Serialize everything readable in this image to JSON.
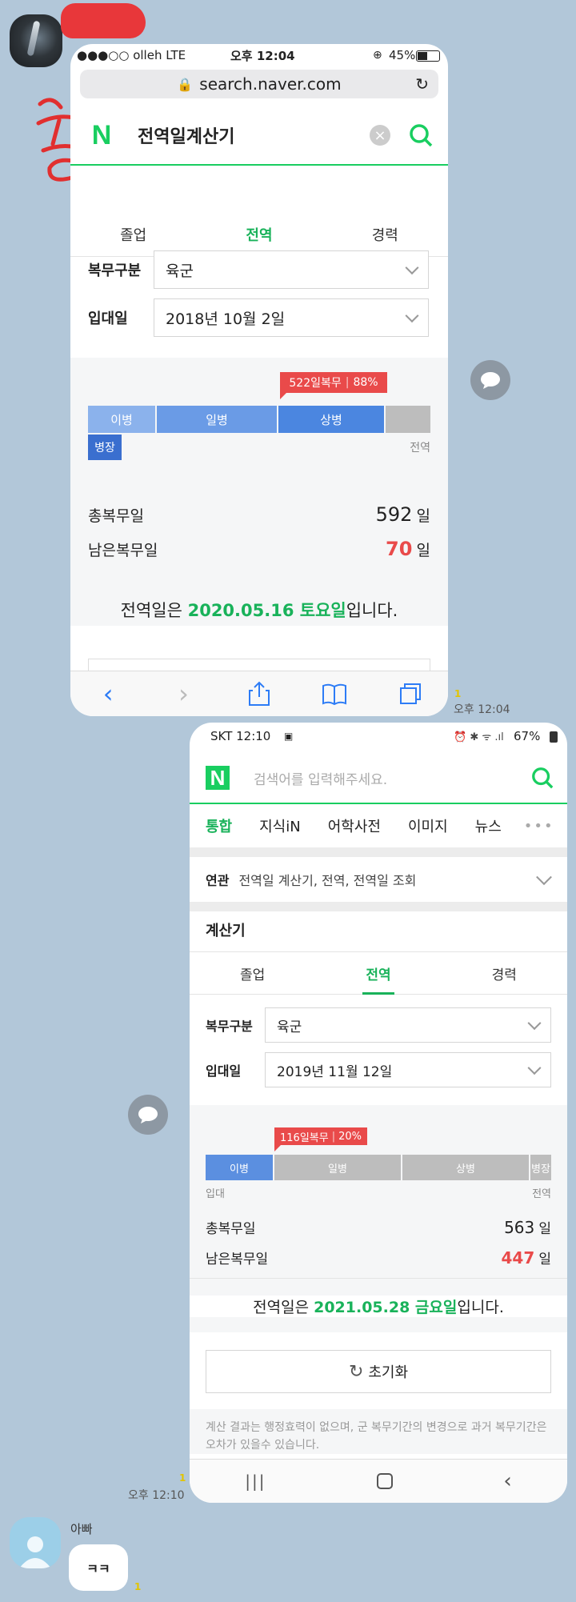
{
  "card1": {
    "status": {
      "carrier": "●●●○○ olleh  LTE",
      "time": "오후 12:04",
      "battery": "45%"
    },
    "url": "search.naver.com",
    "search_title": "전역일계산기",
    "tabs": [
      "졸업",
      "전역",
      "경력"
    ],
    "branch_label": "복무구분",
    "branch_value": "육군",
    "enlist_label": "입대일",
    "enlist_value": "2018년 10월 2일",
    "badge_days": "522일복무",
    "badge_pct": "88%",
    "segments": [
      "이병",
      "일병",
      "상병"
    ],
    "rank_now": "병장",
    "end_label": "전역",
    "total_label": "총복무일",
    "total_value": "592",
    "day_unit": "일",
    "remain_label": "남은복무일",
    "remain_value": "70",
    "result_pre": "전역일은 ",
    "result_date": "2020.05.16 토요일",
    "result_post": "입니다.",
    "progress_pct": 88
  },
  "msg1": {
    "read": "1",
    "time": "오후 12:04"
  },
  "card2": {
    "status": {
      "carrier": "SKT 12:10",
      "battery": "67%"
    },
    "search_placeholder": "검색어를 입력해주세요.",
    "nav": [
      "통합",
      "지식iN",
      "어학사전",
      "이미지",
      "뉴스"
    ],
    "related_label": "연관",
    "related_text": "전역일 계산기, 전역, 전역일 조회",
    "calc_title": "계산기",
    "tabs": [
      "졸업",
      "전역",
      "경력"
    ],
    "branch_label": "복무구분",
    "branch_value": "육군",
    "enlist_label": "입대일",
    "enlist_value": "2019년 11월 12일",
    "badge_days": "116일복무",
    "badge_pct": "20%",
    "segments": [
      "이병",
      "일병",
      "상병",
      "병장"
    ],
    "start_label": "입대",
    "end_label": "전역",
    "total_label": "총복무일",
    "total_value": "563",
    "day_unit": "일",
    "remain_label": "남은복무일",
    "remain_value": "447",
    "result_pre": "전역일은 ",
    "result_date": "2021.05.28 금요일",
    "result_post": "입니다.",
    "reset_label": "초기화",
    "disclaimer": "계산 결과는 행정효력이 없으며, 군 복무기간의 변경으로 과거 복무기간은 오차가 있을수 있습니다.",
    "progress_pct": 20
  },
  "msg2": {
    "read": "1",
    "time": "오후 12:10"
  },
  "reply": {
    "sender": "아빠",
    "text": "ㅋㅋ",
    "read": "1"
  },
  "colors": {
    "naver_green": "#19ce60",
    "red": "#e94a4a",
    "rank_blue": "#5b8fe0"
  }
}
